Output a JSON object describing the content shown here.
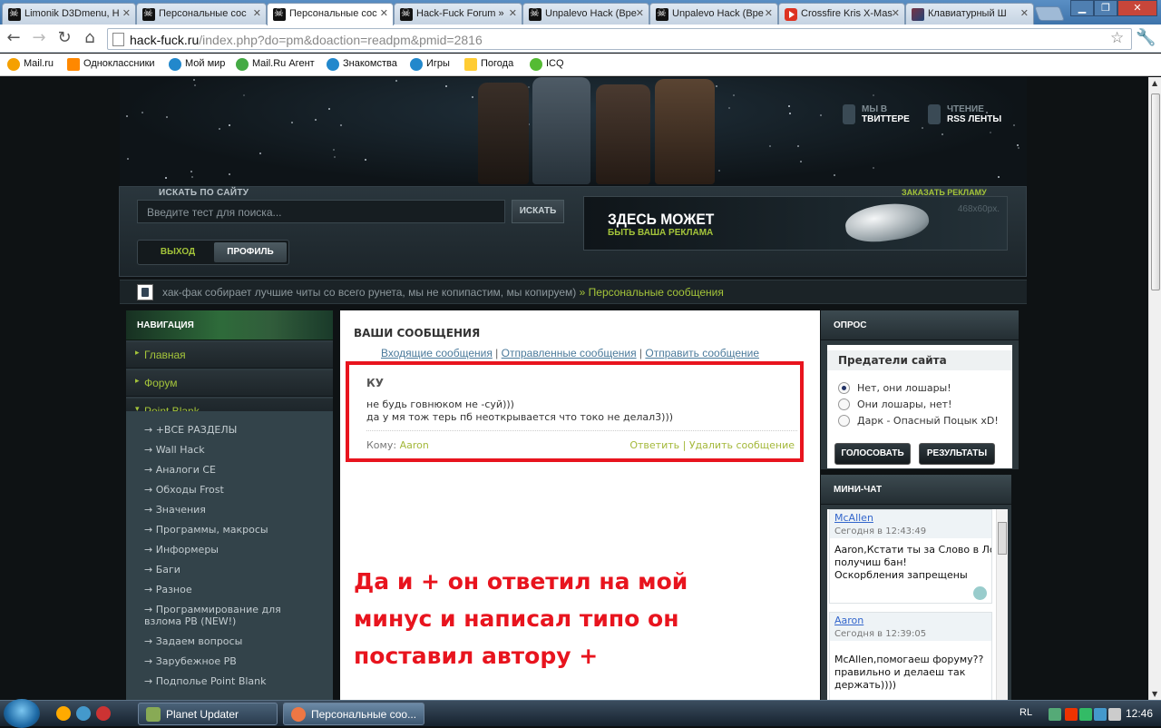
{
  "browser": {
    "tabs": [
      {
        "label": "Limonik D3Dmenu, H",
        "icon": "hack-fuck-icon"
      },
      {
        "label": "Персональные сос",
        "icon": "hack-fuck-icon"
      },
      {
        "label": "Персональные сос",
        "icon": "hack-fuck-icon",
        "active": true
      },
      {
        "label": "Hack-Fuck Forum »",
        "icon": "hack-fuck-icon"
      },
      {
        "label": "Unpalevo Hack (Вре",
        "icon": "hack-fuck-icon"
      },
      {
        "label": "Unpalevo Hack (Вре",
        "icon": "hack-fuck-icon"
      },
      {
        "label": "Crossfire Kris X-Mas",
        "icon": "youtube-icon"
      },
      {
        "label": "Клавиатурный Ш",
        "icon": "pb-icon"
      }
    ],
    "url_host": "hack-fuck.ru",
    "url_path": "/index.php?do=pm&doaction=readpm&pmid=2816",
    "bookmarks": [
      "Mail.ru",
      "Одноклассники",
      "Мой мир",
      "Mail.Ru Агент",
      "Знакомства",
      "Игры",
      "Погода",
      "ICQ"
    ]
  },
  "header": {
    "twitter_top": "МЫ В",
    "twitter_bottom": "ТВИТТЕРЕ",
    "rss_top": "ЧТЕНИЕ",
    "rss_bottom": "RSS ЛЕНТЫ"
  },
  "search": {
    "label": "ИСКАТЬ ПО САЙТУ",
    "placeholder": "Введите тест для поиска...",
    "button": "ИСКАТЬ"
  },
  "account": {
    "logout": "ВЫХОД",
    "profile": "ПРОФИЛЬ"
  },
  "ad": {
    "order_label": "ЗАКАЗАТЬ РЕКЛАМУ",
    "headline": "ЗДЕСЬ МОЖЕТ",
    "subline": "БЫТЬ ВАША РЕКЛАМА",
    "size": "468x60px."
  },
  "breadcrumb": {
    "slogan": "хак-фак собирает лучшие читы со всего рунета, мы не копипастим, мы копируем)",
    "separator": "»",
    "current": "Персональные сообщения"
  },
  "sidebar": {
    "title": "НАВИГАЦИЯ",
    "items": [
      "Главная",
      "Форум",
      "Point Blank"
    ],
    "subitems": [
      "→ +ВСЕ РАЗДЕЛЫ",
      "→ Wall Hack",
      "→ Аналоги CE",
      "→ Обходы Frost",
      "→ Значения",
      "→ Программы, макросы",
      "→ Информеры",
      "→ Баги",
      "→ Разное",
      "→ Программирование для",
      "взлома PB (NEW!)",
      "→ Задаем вопросы",
      "→ Зарубежное PB",
      "→ Подполье Point Blank"
    ]
  },
  "messages": {
    "title": "ВАШИ СООБЩЕНИЯ",
    "links": [
      "Входящие сообщения",
      "Отправленные сообщения",
      "Отправить сообщение"
    ],
    "link_sep": "|",
    "subject": "КУ",
    "body_lines": [
      "не будь говнюком не -суй)))",
      "да у мя тож терь пб неоткрывается что токо не делал3)))"
    ],
    "to_label": "Кому:",
    "to_user": "Aaron",
    "reply": "Ответить",
    "action_sep": "|",
    "delete": "Удалить сообщение",
    "annotation_lines": [
      "Да и + он ответил на мой",
      "минус и написал типо он",
      "поставил автору +"
    ],
    "annotation_color": "#e8141e"
  },
  "poll": {
    "title": "ОПРОС",
    "question": "Предатели сайта",
    "options": [
      "Нет, они лошары!",
      "Они лошары, нет!",
      "Дарк - Опасный Поцык xD!"
    ],
    "selected_index": 0,
    "vote": "ГОЛОСОВАТЬ",
    "results": "РЕЗУЛЬТАТЫ"
  },
  "chat": {
    "title": "МИНИ-ЧАТ",
    "messages": [
      {
        "user": "McAllen",
        "time": "Сегодня в 12:43:49",
        "lines": [
          "Aaron,Кстати ты за Слово в Лс",
          "получиш бан!",
          "Оскорбления запрещены"
        ]
      },
      {
        "user": "Aaron",
        "time": "Сегодня в 12:39:05",
        "lines": [
          "McAllen,помогаеш форуму??",
          "правильно и делаеш так",
          "держать))))"
        ]
      }
    ]
  },
  "taskbar": {
    "items": [
      "Planet Updater",
      "Персональные соо..."
    ],
    "lang": "RL",
    "clock": "12:46"
  }
}
